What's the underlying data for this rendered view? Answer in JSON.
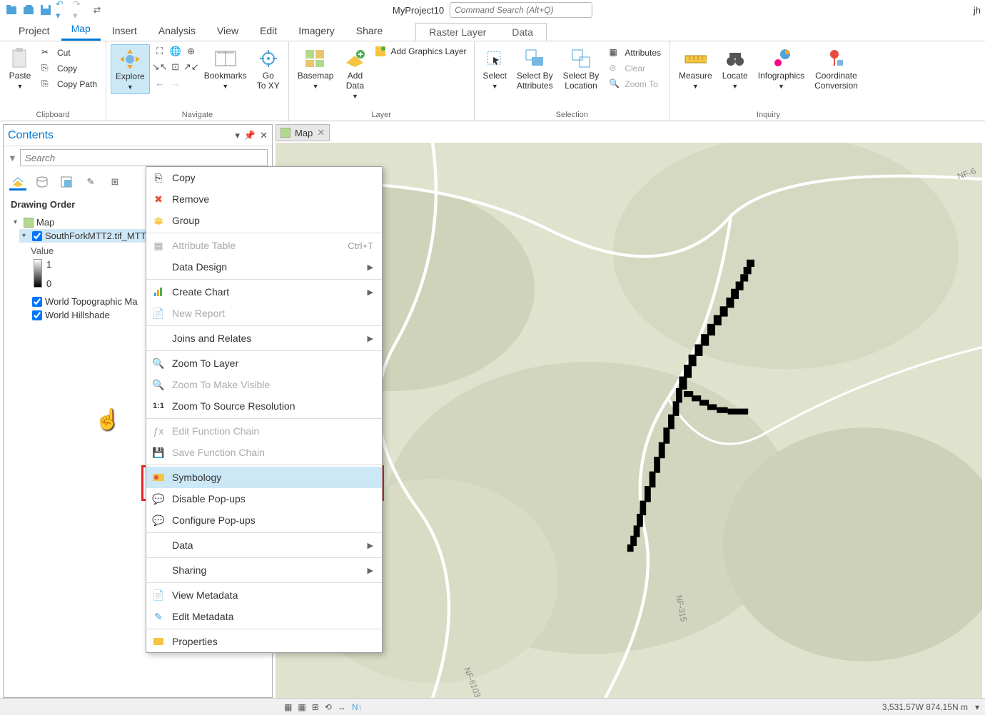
{
  "project_name": "MyProject10",
  "command_search_placeholder": "Command Search (Alt+Q)",
  "user_initials": "jh",
  "tabs": {
    "project": "Project",
    "map": "Map",
    "insert": "Insert",
    "analysis": "Analysis",
    "view": "View",
    "edit": "Edit",
    "imagery": "Imagery",
    "share": "Share",
    "raster_layer": "Raster Layer",
    "data": "Data"
  },
  "ribbon": {
    "clipboard": {
      "paste": "Paste",
      "cut": "Cut",
      "copy": "Copy",
      "copy_path": "Copy Path",
      "label": "Clipboard"
    },
    "navigate": {
      "explore": "Explore",
      "bookmarks": "Bookmarks",
      "go_to_xy": "Go\nTo XY",
      "label": "Navigate"
    },
    "layer": {
      "basemap": "Basemap",
      "add_data": "Add\nData",
      "add_graphics": "Add Graphics Layer",
      "label": "Layer"
    },
    "selection": {
      "select": "Select",
      "select_by_attr": "Select By\nAttributes",
      "select_by_loc": "Select By\nLocation",
      "attributes": "Attributes",
      "clear": "Clear",
      "zoom_to": "Zoom To",
      "label": "Selection"
    },
    "inquiry": {
      "measure": "Measure",
      "locate": "Locate",
      "infographics": "Infographics",
      "coord": "Coordinate\nConversion",
      "label": "Inquiry"
    }
  },
  "contents": {
    "title": "Contents",
    "search_placeholder": "Search",
    "drawing_order": "Drawing Order",
    "map_node": "Map",
    "layer_selected": "SouthForkMTT2.tif_MTT",
    "value_label": "Value",
    "val_max": "1",
    "val_min": "0",
    "world_topo": "World Topographic Ma",
    "world_hillshade": "World Hillshade"
  },
  "map_tab": "Map",
  "context_menu": {
    "copy": "Copy",
    "remove": "Remove",
    "group": "Group",
    "attribute_table": "Attribute Table",
    "attribute_table_short": "Ctrl+T",
    "data_design": "Data Design",
    "create_chart": "Create Chart",
    "new_report": "New Report",
    "joins_relates": "Joins and Relates",
    "zoom_to_layer": "Zoom To Layer",
    "zoom_make_visible": "Zoom To Make Visible",
    "zoom_source_res": "Zoom To Source Resolution",
    "edit_func_chain": "Edit Function Chain",
    "save_func_chain": "Save Function Chain",
    "symbology": "Symbology",
    "disable_popups": "Disable Pop-ups",
    "configure_popups": "Configure Pop-ups",
    "data": "Data",
    "sharing": "Sharing",
    "view_metadata": "View Metadata",
    "edit_metadata": "Edit Metadata",
    "properties": "Properties"
  },
  "statusbar": {
    "coords": "3,531.57W 874.15N m"
  }
}
